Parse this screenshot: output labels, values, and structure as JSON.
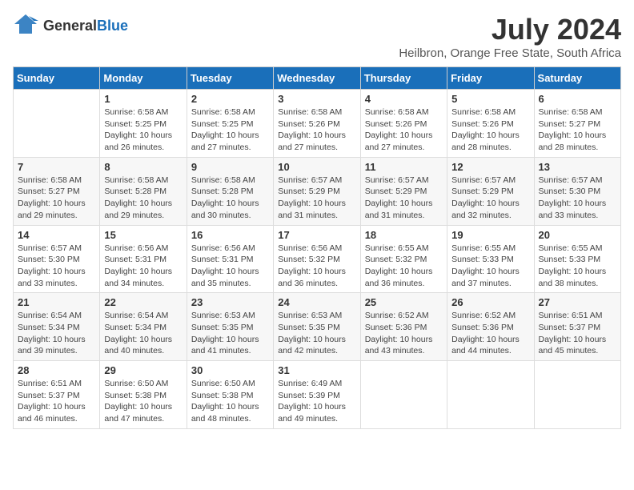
{
  "header": {
    "logo_general": "General",
    "logo_blue": "Blue",
    "month_year": "July 2024",
    "location": "Heilbron, Orange Free State, South Africa"
  },
  "days_of_week": [
    "Sunday",
    "Monday",
    "Tuesday",
    "Wednesday",
    "Thursday",
    "Friday",
    "Saturday"
  ],
  "weeks": [
    [
      {
        "day": "",
        "sunrise": "",
        "sunset": "",
        "daylight": ""
      },
      {
        "day": "1",
        "sunrise": "Sunrise: 6:58 AM",
        "sunset": "Sunset: 5:25 PM",
        "daylight": "Daylight: 10 hours and 26 minutes."
      },
      {
        "day": "2",
        "sunrise": "Sunrise: 6:58 AM",
        "sunset": "Sunset: 5:25 PM",
        "daylight": "Daylight: 10 hours and 27 minutes."
      },
      {
        "day": "3",
        "sunrise": "Sunrise: 6:58 AM",
        "sunset": "Sunset: 5:26 PM",
        "daylight": "Daylight: 10 hours and 27 minutes."
      },
      {
        "day": "4",
        "sunrise": "Sunrise: 6:58 AM",
        "sunset": "Sunset: 5:26 PM",
        "daylight": "Daylight: 10 hours and 27 minutes."
      },
      {
        "day": "5",
        "sunrise": "Sunrise: 6:58 AM",
        "sunset": "Sunset: 5:26 PM",
        "daylight": "Daylight: 10 hours and 28 minutes."
      },
      {
        "day": "6",
        "sunrise": "Sunrise: 6:58 AM",
        "sunset": "Sunset: 5:27 PM",
        "daylight": "Daylight: 10 hours and 28 minutes."
      }
    ],
    [
      {
        "day": "7",
        "sunrise": "Sunrise: 6:58 AM",
        "sunset": "Sunset: 5:27 PM",
        "daylight": "Daylight: 10 hours and 29 minutes."
      },
      {
        "day": "8",
        "sunrise": "Sunrise: 6:58 AM",
        "sunset": "Sunset: 5:28 PM",
        "daylight": "Daylight: 10 hours and 29 minutes."
      },
      {
        "day": "9",
        "sunrise": "Sunrise: 6:58 AM",
        "sunset": "Sunset: 5:28 PM",
        "daylight": "Daylight: 10 hours and 30 minutes."
      },
      {
        "day": "10",
        "sunrise": "Sunrise: 6:57 AM",
        "sunset": "Sunset: 5:29 PM",
        "daylight": "Daylight: 10 hours and 31 minutes."
      },
      {
        "day": "11",
        "sunrise": "Sunrise: 6:57 AM",
        "sunset": "Sunset: 5:29 PM",
        "daylight": "Daylight: 10 hours and 31 minutes."
      },
      {
        "day": "12",
        "sunrise": "Sunrise: 6:57 AM",
        "sunset": "Sunset: 5:29 PM",
        "daylight": "Daylight: 10 hours and 32 minutes."
      },
      {
        "day": "13",
        "sunrise": "Sunrise: 6:57 AM",
        "sunset": "Sunset: 5:30 PM",
        "daylight": "Daylight: 10 hours and 33 minutes."
      }
    ],
    [
      {
        "day": "14",
        "sunrise": "Sunrise: 6:57 AM",
        "sunset": "Sunset: 5:30 PM",
        "daylight": "Daylight: 10 hours and 33 minutes."
      },
      {
        "day": "15",
        "sunrise": "Sunrise: 6:56 AM",
        "sunset": "Sunset: 5:31 PM",
        "daylight": "Daylight: 10 hours and 34 minutes."
      },
      {
        "day": "16",
        "sunrise": "Sunrise: 6:56 AM",
        "sunset": "Sunset: 5:31 PM",
        "daylight": "Daylight: 10 hours and 35 minutes."
      },
      {
        "day": "17",
        "sunrise": "Sunrise: 6:56 AM",
        "sunset": "Sunset: 5:32 PM",
        "daylight": "Daylight: 10 hours and 36 minutes."
      },
      {
        "day": "18",
        "sunrise": "Sunrise: 6:55 AM",
        "sunset": "Sunset: 5:32 PM",
        "daylight": "Daylight: 10 hours and 36 minutes."
      },
      {
        "day": "19",
        "sunrise": "Sunrise: 6:55 AM",
        "sunset": "Sunset: 5:33 PM",
        "daylight": "Daylight: 10 hours and 37 minutes."
      },
      {
        "day": "20",
        "sunrise": "Sunrise: 6:55 AM",
        "sunset": "Sunset: 5:33 PM",
        "daylight": "Daylight: 10 hours and 38 minutes."
      }
    ],
    [
      {
        "day": "21",
        "sunrise": "Sunrise: 6:54 AM",
        "sunset": "Sunset: 5:34 PM",
        "daylight": "Daylight: 10 hours and 39 minutes."
      },
      {
        "day": "22",
        "sunrise": "Sunrise: 6:54 AM",
        "sunset": "Sunset: 5:34 PM",
        "daylight": "Daylight: 10 hours and 40 minutes."
      },
      {
        "day": "23",
        "sunrise": "Sunrise: 6:53 AM",
        "sunset": "Sunset: 5:35 PM",
        "daylight": "Daylight: 10 hours and 41 minutes."
      },
      {
        "day": "24",
        "sunrise": "Sunrise: 6:53 AM",
        "sunset": "Sunset: 5:35 PM",
        "daylight": "Daylight: 10 hours and 42 minutes."
      },
      {
        "day": "25",
        "sunrise": "Sunrise: 6:52 AM",
        "sunset": "Sunset: 5:36 PM",
        "daylight": "Daylight: 10 hours and 43 minutes."
      },
      {
        "day": "26",
        "sunrise": "Sunrise: 6:52 AM",
        "sunset": "Sunset: 5:36 PM",
        "daylight": "Daylight: 10 hours and 44 minutes."
      },
      {
        "day": "27",
        "sunrise": "Sunrise: 6:51 AM",
        "sunset": "Sunset: 5:37 PM",
        "daylight": "Daylight: 10 hours and 45 minutes."
      }
    ],
    [
      {
        "day": "28",
        "sunrise": "Sunrise: 6:51 AM",
        "sunset": "Sunset: 5:37 PM",
        "daylight": "Daylight: 10 hours and 46 minutes."
      },
      {
        "day": "29",
        "sunrise": "Sunrise: 6:50 AM",
        "sunset": "Sunset: 5:38 PM",
        "daylight": "Daylight: 10 hours and 47 minutes."
      },
      {
        "day": "30",
        "sunrise": "Sunrise: 6:50 AM",
        "sunset": "Sunset: 5:38 PM",
        "daylight": "Daylight: 10 hours and 48 minutes."
      },
      {
        "day": "31",
        "sunrise": "Sunrise: 6:49 AM",
        "sunset": "Sunset: 5:39 PM",
        "daylight": "Daylight: 10 hours and 49 minutes."
      },
      {
        "day": "",
        "sunrise": "",
        "sunset": "",
        "daylight": ""
      },
      {
        "day": "",
        "sunrise": "",
        "sunset": "",
        "daylight": ""
      },
      {
        "day": "",
        "sunrise": "",
        "sunset": "",
        "daylight": ""
      }
    ]
  ]
}
